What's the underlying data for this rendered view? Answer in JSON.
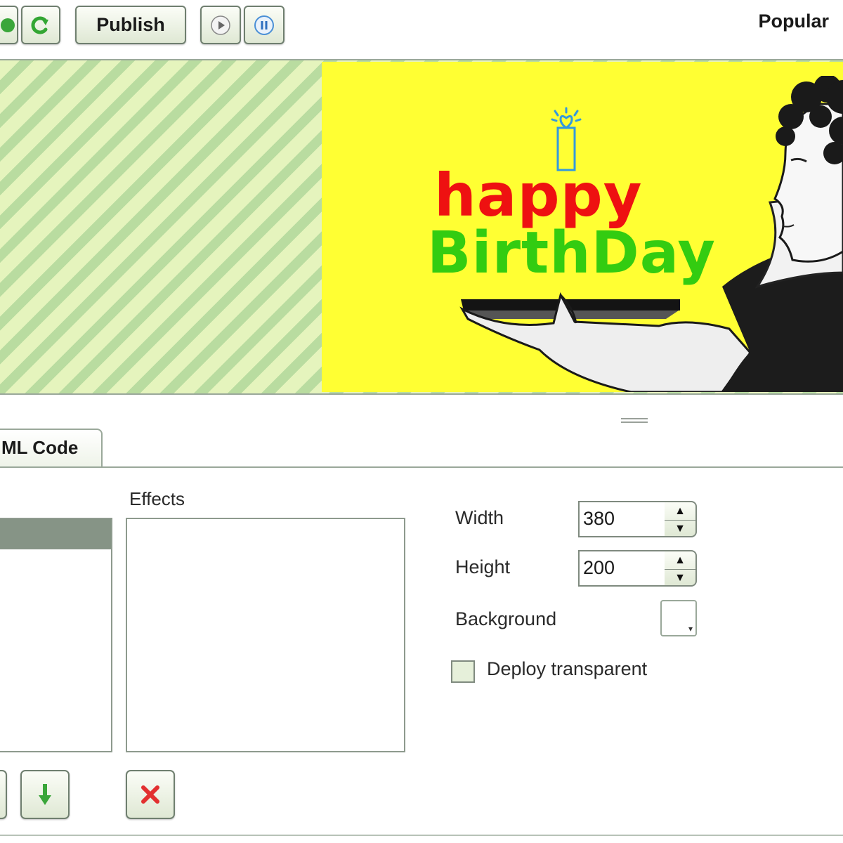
{
  "toolbar": {
    "publish_label": "Publish",
    "popular_label": "Popular",
    "icons": [
      "play-green-icon",
      "redo-icon",
      "play-icon",
      "pause-icon"
    ]
  },
  "preview": {
    "happy_text": "happy",
    "birthday_text": "BirthDay",
    "colors": {
      "banner_background": "#ffff33",
      "happy": "#ee1111",
      "birthday": "#33cc11",
      "stripe_light": "#e5f4bd",
      "stripe_dark": "#b9dca0"
    }
  },
  "tabs": {
    "html_code_label": "ML Code"
  },
  "effects": {
    "label": "Effects"
  },
  "properties": {
    "width_label": "Width",
    "width_value": "380",
    "height_label": "Height",
    "height_value": "200",
    "background_label": "Background",
    "background_color": "#ffffff",
    "deploy_label": "Deploy transparent",
    "deploy_checked": false
  },
  "actions": {
    "icons": [
      "move-down-icon",
      "delete-icon"
    ]
  }
}
